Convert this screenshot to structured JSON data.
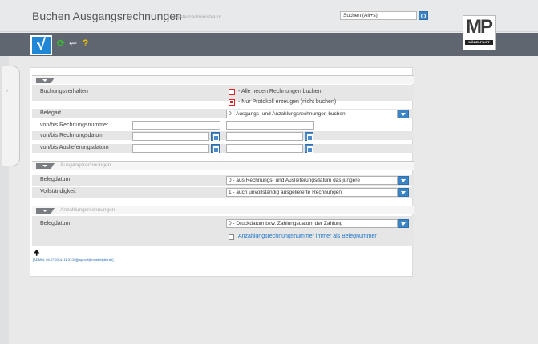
{
  "header": {
    "title": "Buchen Ausgangsrechnungen",
    "user": "Systemadministrator",
    "search_value": "Suchen (Alt+s)"
  },
  "logo": {
    "brand": "MÖBELPILOT"
  },
  "toolbar": {
    "ok_glyph": "√",
    "refresh_glyph": "⟳",
    "back_glyph": "⇜",
    "help_glyph": "?"
  },
  "filter": {
    "buchungsverhalten_label": "Buchungsverhalten",
    "options": [
      {
        "label": "- Alle neuen Rechnungen buchen",
        "selected": false
      },
      {
        "label": "- Nur Protokoll erzeugen (nicht buchen)",
        "selected": true
      }
    ],
    "belegart_label": "Belegart",
    "belegart_value": "0 - Ausgangs- und Anzahlungsrechnungen buchen",
    "rechnungsnummer_label": "von/bis Rechnungsnummer",
    "rechnungsdatum_label": "von/bis Rechnungsdatum",
    "auslieferungsdatum_label": "von/bis Auslieferungsdatum"
  },
  "ausgangsrechnungen": {
    "section_label": "Ausgangsrechnungen",
    "belegdatum_label": "Belegdatum",
    "belegdatum_value": "0 - aus Rechnungs- und Auslieferungsdatum das jüngere",
    "vollstaendigkeit_label": "Vollständigkeit",
    "vollstaendigkeit_value": "1 - auch unvollständig ausgelieferte Rechnungen"
  },
  "anzahlungsrechnungen": {
    "section_label": "Anzahlungsrechnungen",
    "belegdatum_label": "Belegdatum",
    "belegdatum_value": "0 - Druckdatum bzw. Zahlungsdatum der Zahlung",
    "checkbox_label": "Anzahlungsrechnungsnummer immer als Belegnummer"
  },
  "footer": {
    "arrow": "🠉",
    "info": "[ADMIN, 04.07.2014, 11:37:20][support@moebelpilot.de]"
  },
  "colors": {
    "accent": "#1f87d6",
    "toolbar": "#606670",
    "radio": "#dd2222",
    "link": "#1e74c6"
  }
}
